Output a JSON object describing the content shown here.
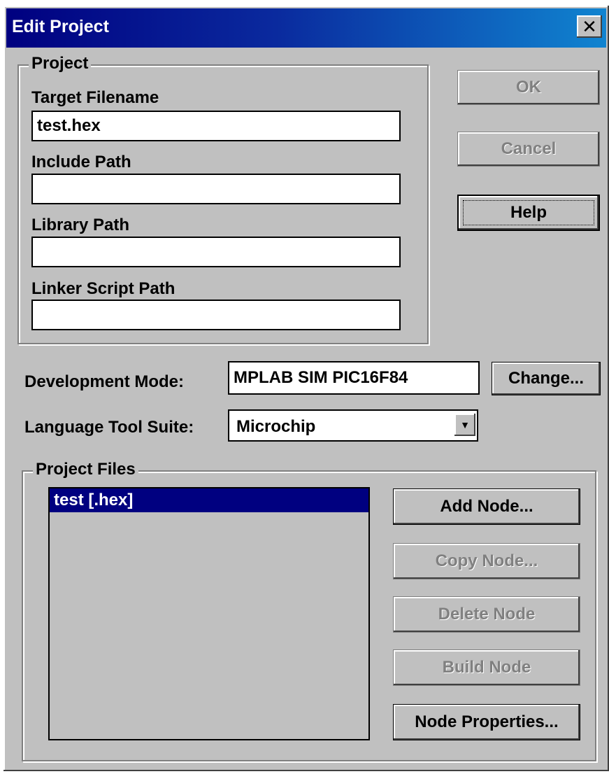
{
  "window": {
    "title": "Edit Project",
    "close_symbol": "✕"
  },
  "project_group": {
    "label": "Project",
    "target_filename_label": "Target Filename",
    "target_filename_value": "test.hex",
    "include_path_label": "Include Path",
    "include_path_value": "",
    "library_path_label": "Library Path",
    "library_path_value": "",
    "linker_script_path_label": "Linker Script Path",
    "linker_script_path_value": ""
  },
  "buttons": {
    "ok": "OK",
    "cancel": "Cancel",
    "help": "Help",
    "change": "Change..."
  },
  "development_mode": {
    "label": "Development Mode:",
    "value": "MPLAB SIM PIC16F84"
  },
  "language_tool_suite": {
    "label": "Language Tool Suite:",
    "value": "Microchip",
    "arrow": "▼"
  },
  "project_files": {
    "label": "Project Files",
    "items": [
      "test [.hex]"
    ],
    "add_node": "Add Node...",
    "copy_node": "Copy Node...",
    "delete_node": "Delete Node",
    "build_node": "Build Node",
    "node_properties": "Node Properties..."
  }
}
